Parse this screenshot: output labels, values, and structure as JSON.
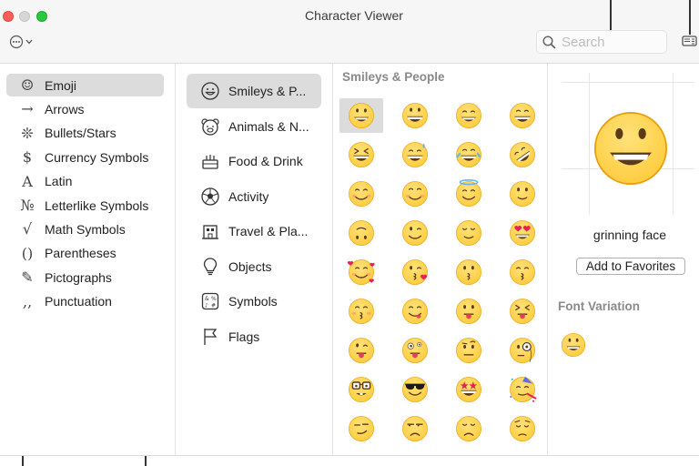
{
  "window": {
    "title": "Character Viewer"
  },
  "toolbar": {
    "action_icon": "ellipsis-circle-icon",
    "search_placeholder": "Search",
    "search_value": "",
    "toggle_icon": "sidebar-toggle-icon"
  },
  "categories": [
    {
      "glyph": "☺",
      "label": "Emoji",
      "selected": true
    },
    {
      "glyph": "→",
      "label": "Arrows"
    },
    {
      "glyph": "❊",
      "label": "Bullets/Stars"
    },
    {
      "glyph": "$",
      "label": "Currency Symbols"
    },
    {
      "glyph": "A",
      "label": "Latin"
    },
    {
      "glyph": "№",
      "label": "Letterlike Symbols"
    },
    {
      "glyph": "√",
      "label": "Math Symbols"
    },
    {
      "glyph": "()",
      "label": "Parentheses"
    },
    {
      "glyph": "✎",
      "label": "Pictographs"
    },
    {
      "glyph": "‚‚",
      "label": "Punctuation"
    }
  ],
  "groups": [
    {
      "icon": "smiley-icon",
      "label": "Smileys & P...",
      "selected": true
    },
    {
      "icon": "bear-icon",
      "label": "Animals & N..."
    },
    {
      "icon": "cake-icon",
      "label": "Food & Drink"
    },
    {
      "icon": "soccer-ball-icon",
      "label": "Activity"
    },
    {
      "icon": "building-icon",
      "label": "Travel & Pla..."
    },
    {
      "icon": "lightbulb-icon",
      "label": "Objects"
    },
    {
      "icon": "symbols-icon",
      "label": "Symbols"
    },
    {
      "icon": "flag-icon",
      "label": "Flags"
    }
  ],
  "grid": {
    "header": "Smileys & People",
    "selected_index": 0,
    "emoji": [
      "grinning",
      "grin-wide",
      "smile",
      "beam",
      "squint",
      "sweat",
      "joy",
      "rofl",
      "smiling-relaxed",
      "blush",
      "halo",
      "slight-smile",
      "upside-down",
      "wink",
      "relieved",
      "heart-eyes",
      "hearts",
      "kiss-heart",
      "kissing",
      "kiss-smile",
      "kiss-closed",
      "yum",
      "tongue",
      "squint-tongue",
      "wink-tongue",
      "zany",
      "raised-brow",
      "monocle",
      "nerd",
      "sunglasses",
      "star-struck",
      "party",
      "smirk",
      "unamused",
      "disappointed",
      "pensive"
    ]
  },
  "detail": {
    "preview_icon": "grinning-face-large-icon",
    "name": "grinning face",
    "add_favorites_label": "Add to Favorites",
    "font_variation_title": "Font Variation"
  },
  "colors": {
    "emoji_face": "#FFCB3B",
    "emoji_edge": "#E9A010",
    "feature": "#5B3A16",
    "selection": "#DCDCDC"
  }
}
